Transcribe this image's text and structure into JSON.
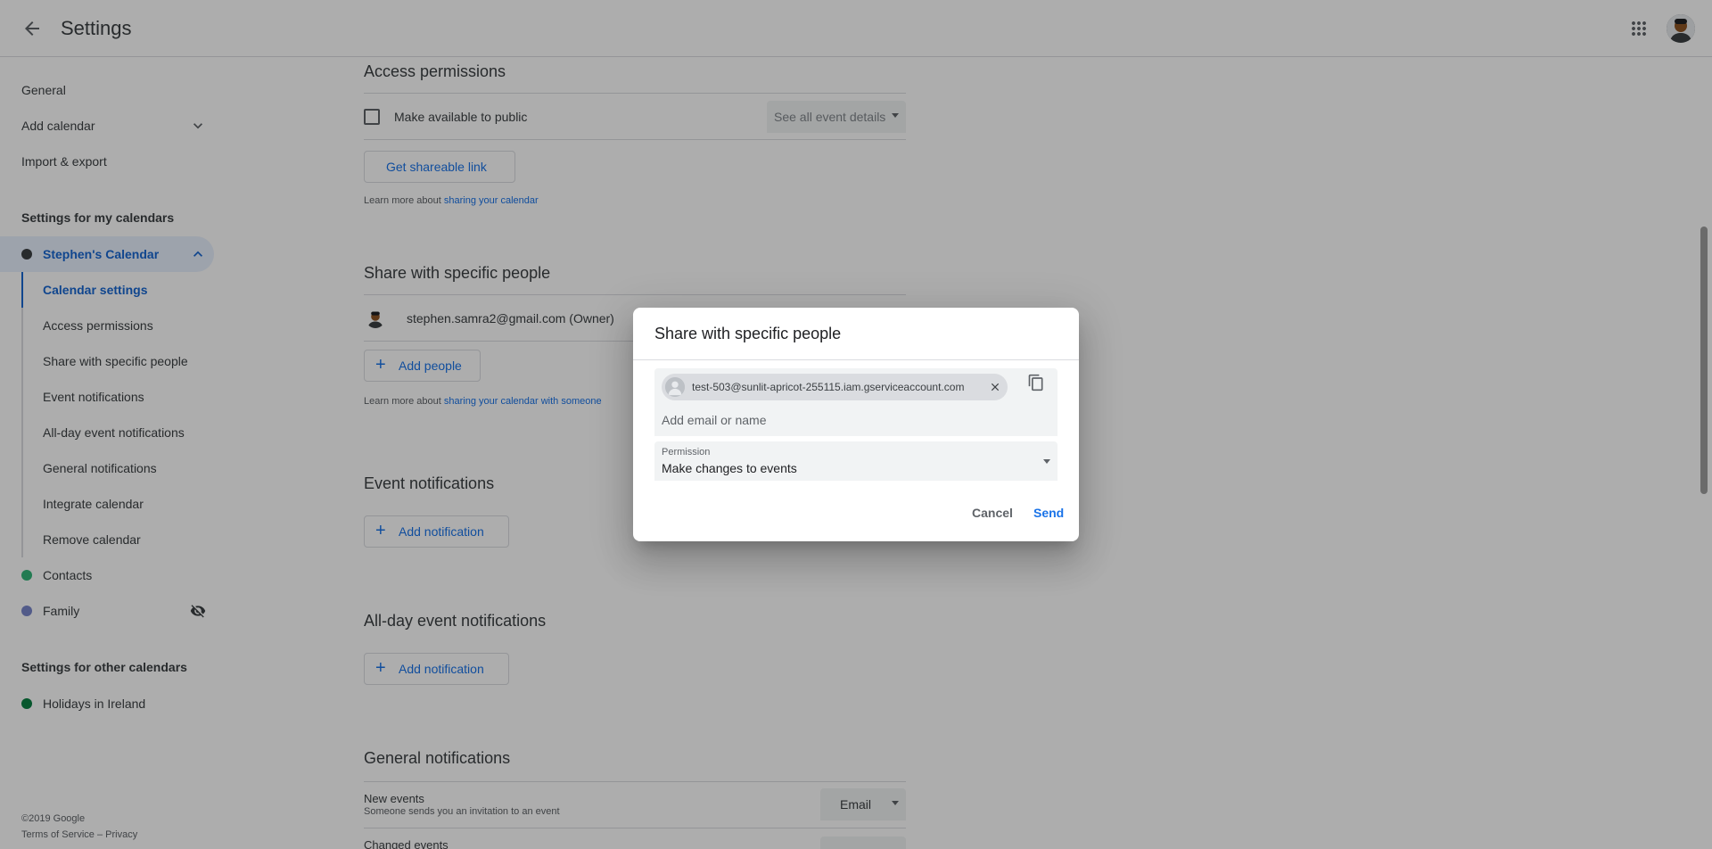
{
  "header": {
    "title": "Settings"
  },
  "sidebar": {
    "items": [
      {
        "label": "General"
      },
      {
        "label": "Add calendar"
      },
      {
        "label": "Import & export"
      }
    ],
    "my_calendars_heading": "Settings for my calendars",
    "calendars": [
      {
        "label": "Stephen's Calendar",
        "color": "#3c4043"
      },
      {
        "label": "Contacts",
        "color": "#33b679"
      },
      {
        "label": "Family",
        "color": "#7986cb"
      }
    ],
    "sub_items": [
      {
        "label": "Calendar settings"
      },
      {
        "label": "Access permissions"
      },
      {
        "label": "Share with specific people"
      },
      {
        "label": "Event notifications"
      },
      {
        "label": "All-day event notifications"
      },
      {
        "label": "General notifications"
      },
      {
        "label": "Integrate calendar"
      },
      {
        "label": "Remove calendar"
      }
    ],
    "other_calendars_heading": "Settings for other calendars",
    "other_calendars": [
      {
        "label": "Holidays in Ireland",
        "color": "#0b8043"
      }
    ],
    "footer": {
      "copyright": "©2019 Google",
      "links": "Terms of Service – Privacy"
    }
  },
  "main": {
    "access": {
      "title": "Access permissions",
      "public_label": "Make available to public",
      "visibility_value": "See all event details",
      "shareable_link_label": "Get shareable link",
      "learn_prefix": "Learn more about ",
      "learn_link": "sharing your calendar"
    },
    "share": {
      "title": "Share with specific people",
      "owner": "stephen.samra2@gmail.com (Owner)",
      "add_people_label": "Add people",
      "learn_prefix": "Learn more about ",
      "learn_link": "sharing your calendar with someone"
    },
    "event_notifications": {
      "title": "Event notifications",
      "add_label": "Add notification"
    },
    "allday_notifications": {
      "title": "All-day event notifications",
      "add_label": "Add notification"
    },
    "general_notifications": {
      "title": "General notifications",
      "new_events_title": "New events",
      "new_events_desc": "Someone sends you an invitation to an event",
      "new_events_value": "Email",
      "changed_events_title": "Changed events"
    }
  },
  "dialog": {
    "title": "Share with specific people",
    "chip_email": "test-503@sunlit-apricot-255115.iam.gserviceaccount.com",
    "input_placeholder": "Add email or name",
    "permission_label": "Permission",
    "permission_value": "Make changes to events",
    "cancel_label": "Cancel",
    "send_label": "Send"
  }
}
